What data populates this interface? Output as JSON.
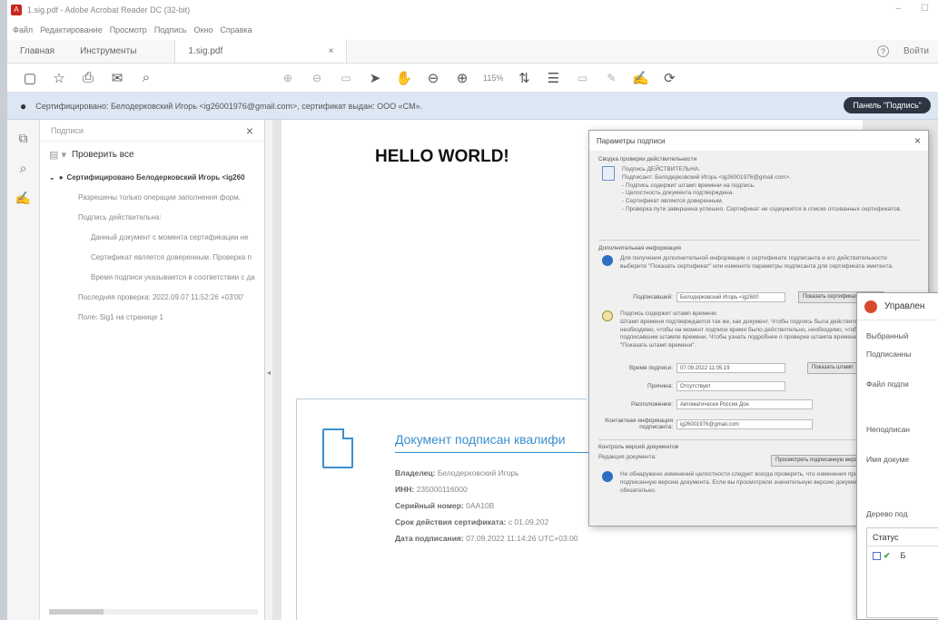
{
  "window": {
    "title": "1.sig.pdf - Adobe Acrobat Reader DC (32-bit)",
    "controls": [
      "–",
      "☐"
    ]
  },
  "menu": [
    "Файл",
    "Редактирование",
    "Просмотр",
    "Подпись",
    "Окно",
    "Справка"
  ],
  "tabs": {
    "home": "Главная",
    "tools": "Инструменты",
    "doc": "1.sig.pdf",
    "help": "?",
    "signin": "Войти"
  },
  "toolbar": {
    "zoom": "115%"
  },
  "signature_bar": {
    "text": "Сертифицировано: Белодерковский Игорь <ig26001976@gmail.com>, сертификат выдан: ООО «CM».",
    "panel_button": "Панель \"Подпись\""
  },
  "sig_panel": {
    "title": "Подписи",
    "validate_all": "Проверить все",
    "items": [
      {
        "text": "Сертифицировано Белодерковский Игорь <ig260",
        "level": "top"
      },
      {
        "text": "Разрешены только операции заполнения форм,",
        "level": "l1"
      },
      {
        "text": "Подпись действительна:",
        "level": "l1"
      },
      {
        "text": "Данный документ с момента сертификации не",
        "level": "l2"
      },
      {
        "text": "Сертификат является доверенным. Проверка п",
        "level": "l2"
      },
      {
        "text": "Время подписи указывается в соответствии с да",
        "level": "l2"
      },
      {
        "text": "Последняя проверка: 2022.09.07 11:52:26 +03'00'",
        "level": "l1"
      },
      {
        "text": "Поле: Sig1 на странице 1",
        "level": "l1"
      }
    ]
  },
  "document": {
    "heading": "HELLO WORLD!",
    "stamp": {
      "title": "Документ подписан квалифи",
      "owner_label": "Владелец:",
      "owner": "Белодерковский Игорь",
      "inn_label": "ИНН:",
      "inn": "235000116000",
      "serial_label": "Серийный номер:",
      "serial": "0AA10B",
      "validity_label": "Срок действия сертификата:",
      "validity": "с 01.09.202",
      "date_label": "Дата подписания:",
      "date": "07.09.2022 11:14:26 UTC+03:00"
    }
  },
  "dialog": {
    "title": "Параметры подписи",
    "summary_title": "Сводка проверки действительности",
    "summary_text": "Подпись ДЕЙСТВИТЕЛЬНА.\nПодписант: Белодерковский Игорь <ig26001976@gmail.com>.\n- Подпись содержит штамп времени на подпись.\n- Целостность документа подтверждена.\n- Сертификат является доверенным.\n- Проверка пути завершена успешно. Сертификат не содержится в списке отозванных сертификатов.",
    "extra_title": "Дополнительная информация",
    "extra_text": "Для получения дополнительной информации о сертификате подписанта и его действительности выберите \"Показать сертификат\" или измените параметры подписанта для сертификата эмитента.",
    "signer_label": "Подписавший:",
    "signer_value": "Белодерковский Игорь <ig2600",
    "show_cert": "Показать сертификат...",
    "timestamp_text": "Подпись содержит штамп времени.\nШтамп времени подтверждается так же, как документ. Чтобы подпись была действительной, необходимо, чтобы на момент подписи время было действительно, необходимо, чтобы на объявленный подписавшим штампе времени. Чтобы узнать подробнее о проверке штампа времени, выберите \"Показать штамп времени\".",
    "signtime_label": "Время подписи:",
    "signtime_value": "07.09.2022 11:05:19",
    "show_ts": "Показать штамп",
    "reason_label": "Причина:",
    "reason_value": "Отсутствует",
    "location_label": "Расположение:",
    "location_value": "Автоматически Россия Дон",
    "contact_label": "Контактная информация подписанта:",
    "contact_value": "ig26001976@gmail.com",
    "version_title": "Контроль версий документов",
    "revision_label": "Редакция документа:",
    "view_version": "Просмотреть подписанную версию",
    "version_text": "Не обнаружено изменений целостности следует всегда проверять, что изменения просмотрены подписанную версию документа. Если вы просмотрели значительную версию документа, это не обязательно."
  },
  "manager": {
    "title": "Управлен",
    "selected": "Выбранный",
    "signed": "Подписанны",
    "sig_file": "Файл подпи",
    "unsigned": "Неподписан",
    "doc_name": "Имя докуме",
    "tree_title": "Дерево под",
    "status_header": "Статус",
    "row_text": "Б"
  }
}
